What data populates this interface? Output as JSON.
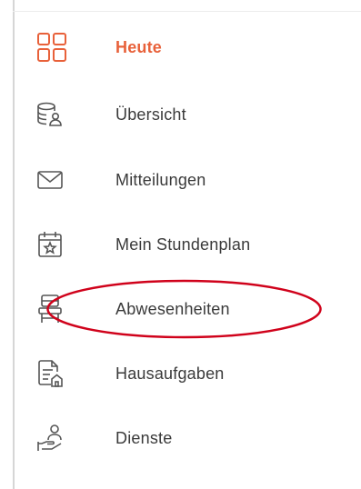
{
  "sidebar": {
    "accent_color": "#e8613a",
    "annotation_color": "#d0021b",
    "items": [
      {
        "label": "Heute",
        "icon": "dashboard-grid-icon",
        "active": true
      },
      {
        "label": "Übersicht",
        "icon": "database-person-icon",
        "active": false
      },
      {
        "label": "Mitteilungen",
        "icon": "envelope-icon",
        "active": false
      },
      {
        "label": "Mein Stundenplan",
        "icon": "calendar-star-icon",
        "active": false
      },
      {
        "label": "Abwesenheiten",
        "icon": "chair-icon",
        "active": false,
        "highlighted": true
      },
      {
        "label": "Hausaufgaben",
        "icon": "document-house-icon",
        "active": false
      },
      {
        "label": "Dienste",
        "icon": "hand-person-icon",
        "active": false
      }
    ]
  }
}
